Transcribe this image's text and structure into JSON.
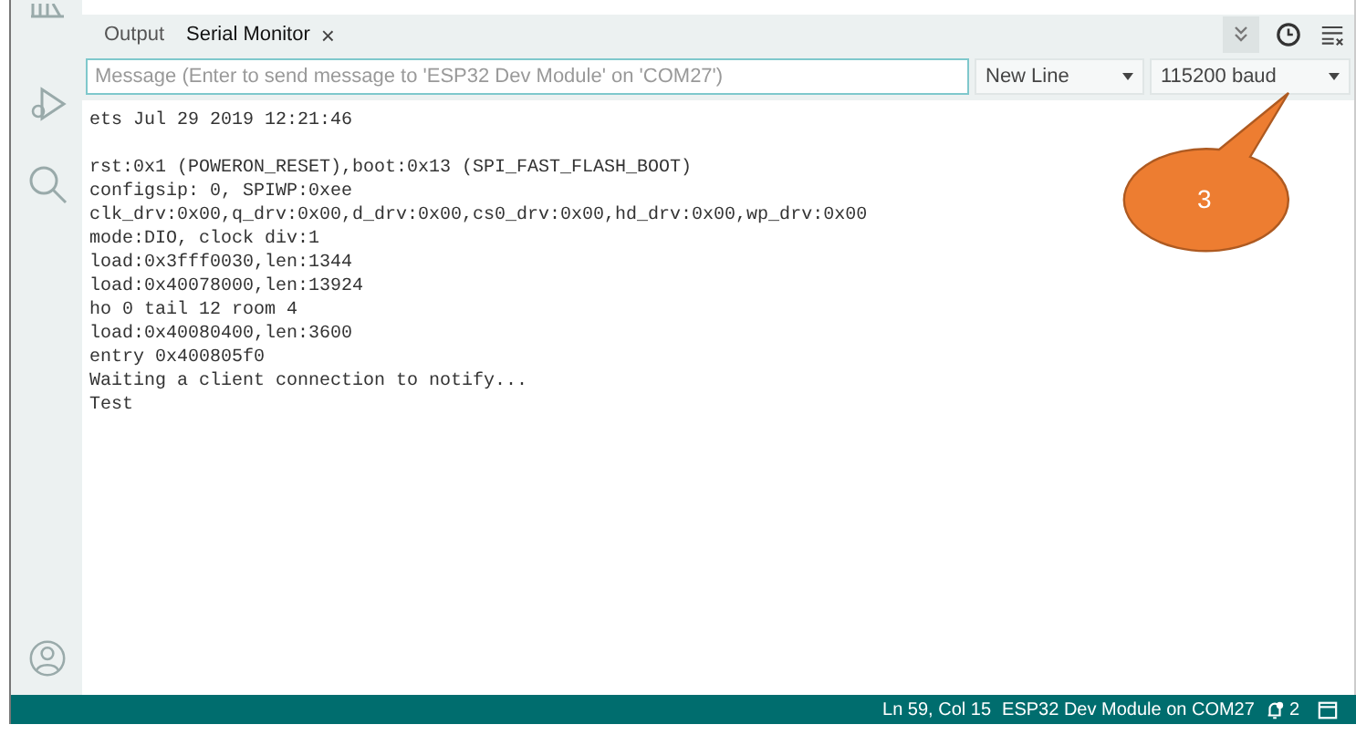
{
  "tabs": [
    {
      "label": "Output",
      "selected": false,
      "closable": false
    },
    {
      "label": "Serial Monitor",
      "selected": true,
      "closable": true
    }
  ],
  "close_glyph": "×",
  "message_field": {
    "placeholder": "Message (Enter to send message to 'ESP32 Dev Module' on 'COM27')"
  },
  "line_ending": {
    "value": "New Line"
  },
  "baud_rate": {
    "value": "115200 baud"
  },
  "boot_banner": "ets Jul 29 2019 12:21:46",
  "output_lines": [
    "rst:0x1 (POWERON_RESET),boot:0x13 (SPI_FAST_FLASH_BOOT)",
    "configsip: 0, SPIWP:0xee",
    "clk_drv:0x00,q_drv:0x00,d_drv:0x00,cs0_drv:0x00,hd_drv:0x00,wp_drv:0x00",
    "mode:DIO, clock div:1",
    "load:0x3fff0030,len:1344",
    "load:0x40078000,len:13924",
    "ho 0 tail 12 room 4",
    "load:0x40080400,len:3600",
    "entry 0x400805f0",
    "Waiting a client connection to notify...",
    "Test"
  ],
  "callout": {
    "label": "3"
  },
  "status_bar": {
    "position": "Ln 59, Col 15",
    "board": "ESP32 Dev Module on COM27",
    "notifications": "2"
  }
}
